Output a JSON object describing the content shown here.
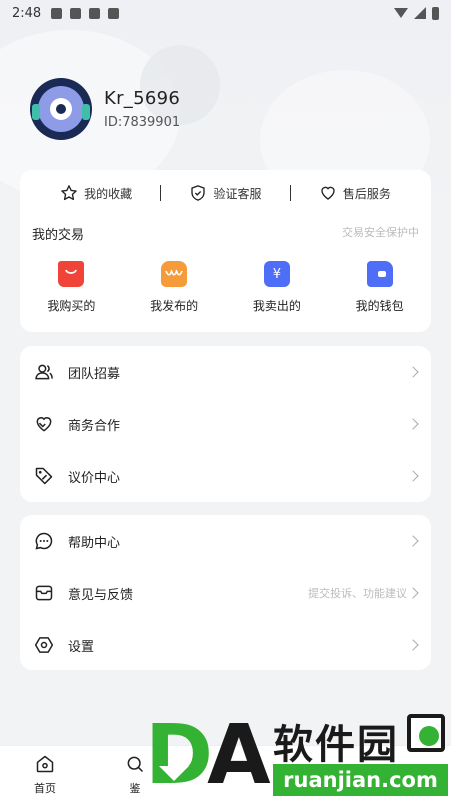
{
  "status_bar": {
    "time": "2:48"
  },
  "profile": {
    "username": "Kr_5696",
    "user_id": "ID:7839901"
  },
  "quick_links": [
    {
      "label": "我的收藏",
      "icon": "star-icon"
    },
    {
      "label": "验证客服",
      "icon": "shield-check-icon"
    },
    {
      "label": "售后服务",
      "icon": "heart-icon"
    }
  ],
  "trade": {
    "title": "我的交易",
    "subtitle": "交易安全保护中",
    "items": [
      {
        "label": "我购买的",
        "icon": "shopping-bag-icon",
        "color": "#f04438"
      },
      {
        "label": "我发布的",
        "icon": "store-icon",
        "color": "#f59b3a"
      },
      {
        "label": "我卖出的",
        "icon": "yuan-icon",
        "color": "#4f6ef7",
        "glyph": "¥"
      },
      {
        "label": "我的钱包",
        "icon": "wallet-icon",
        "color": "#4f6ef7"
      }
    ]
  },
  "menu_group_1": [
    {
      "label": "团队招募",
      "icon": "team-icon"
    },
    {
      "label": "商务合作",
      "icon": "handshake-heart-icon"
    },
    {
      "label": "议价中心",
      "icon": "price-tag-icon"
    }
  ],
  "menu_group_2": [
    {
      "label": "帮助中心",
      "icon": "chat-bubble-icon",
      "hint": ""
    },
    {
      "label": "意见与反馈",
      "icon": "feedback-box-icon",
      "hint": "提交投诉、功能建议"
    },
    {
      "label": "设置",
      "icon": "settings-hexagon-icon",
      "hint": ""
    }
  ],
  "tab_bar": [
    {
      "label": "首页",
      "icon": "home-icon"
    },
    {
      "label": "鉴",
      "icon": "search-icon"
    }
  ],
  "watermark": {
    "text_cn": "软件园",
    "url": "ruanjian.com",
    "letters": "DA"
  }
}
